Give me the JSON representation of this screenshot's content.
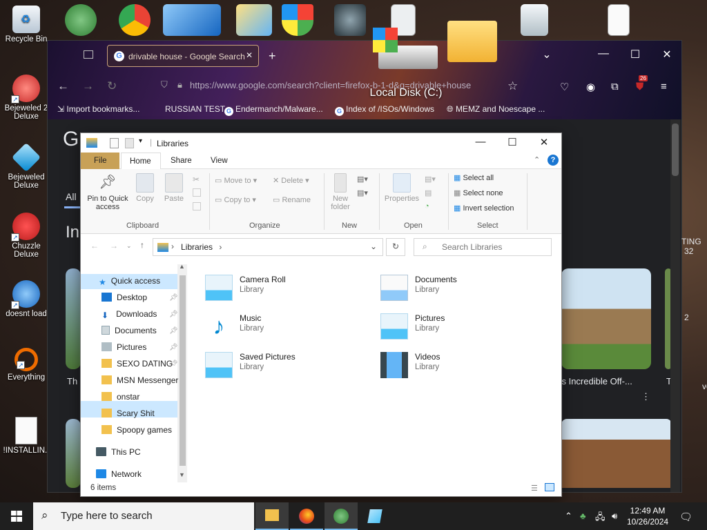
{
  "desktop_icons": [
    {
      "label": "Recycle Bin",
      "color": "#dfe6ee"
    },
    {
      "label": "Bejeweled 2 Deluxe",
      "line1": "Bejeweled 2",
      "line2": "Deluxe",
      "color": "#c62828"
    },
    {
      "label": "Bejeweled Deluxe",
      "line1": "Bejeweled",
      "line2": "Deluxe",
      "color": "#29b6f6"
    },
    {
      "label": "Chuzzle Deluxe",
      "line1": "Chuzzle",
      "line2": "Deluxe",
      "color": "#d32f2f"
    },
    {
      "label": "doesnt load",
      "color": "#1e88e5"
    },
    {
      "label": "Everything",
      "color": "#ef6c00"
    },
    {
      "label": "!INSTALLIN..",
      "color": "#f5f5f5"
    }
  ],
  "overlay_label": "Local Disk (C:)",
  "browser": {
    "tab_title": "drivable house - Google Search",
    "tab_close": "✕",
    "new_tab": "+",
    "url": "https://www.google.com/search?client=firefox-b-1-d&q=drivable+house",
    "extension_badge": "26",
    "bookmarks": [
      "Import bookmarks...",
      "RUSSIAN TEST",
      "Endermanch/Malware...",
      "Index of /ISOs/Windows",
      "MEMZ and Noescape ..."
    ],
    "behind_text": {
      "logo_letter": "G",
      "tab_all": "All",
      "heading_fragment": "In",
      "card_text_left": "Th",
      "card_text_right": "'s Incredible Off-...",
      "card_text_far": "T",
      "card_text_far2": "ved",
      "right_edge_1": "TING",
      "right_edge_2": "32",
      "right_edge_3": "2"
    }
  },
  "explorer": {
    "title": "Libraries",
    "ribbon_tabs": {
      "file": "File",
      "home": "Home",
      "share": "Share",
      "view": "View"
    },
    "clipboard": {
      "pin": "Pin to Quick access",
      "pin_l1": "Pin to Quick",
      "pin_l2": "access",
      "copy": "Copy",
      "paste": "Paste",
      "group": "Clipboard"
    },
    "organize": {
      "move_to": "Move to",
      "copy_to": "Copy to",
      "delete": "Delete",
      "rename": "Rename",
      "group": "Organize"
    },
    "new": {
      "new_folder_l1": "New",
      "new_folder_l2": "folder",
      "group": "New"
    },
    "open": {
      "properties": "Properties",
      "group": "Open"
    },
    "select": {
      "select_all": "Select all",
      "select_none": "Select none",
      "invert": "Invert selection",
      "group": "Select"
    },
    "address": "Libraries",
    "address_sep": "›",
    "search_placeholder": "Search Libraries",
    "nav": [
      {
        "label": "Quick access",
        "color": "#1e88e5",
        "pinned": false
      },
      {
        "label": "Desktop",
        "color": "#1976d2",
        "pinned": true
      },
      {
        "label": "Downloads",
        "color": "#1565c0",
        "pinned": true
      },
      {
        "label": "Documents",
        "color": "#90a4ae",
        "pinned": true
      },
      {
        "label": "Pictures",
        "color": "#78909c",
        "pinned": true
      },
      {
        "label": "SEXO DATING",
        "color": "#f2c14e",
        "pinned": true
      },
      {
        "label": "MSN Messenger",
        "color": "#f2c14e",
        "pinned": false
      },
      {
        "label": "onstar",
        "color": "#f2c14e",
        "pinned": false
      },
      {
        "label": "Scary Shit",
        "color": "#f2c14e",
        "pinned": false
      },
      {
        "label": "Spoopy games",
        "color": "#f2c14e",
        "pinned": false
      },
      {
        "label": "This PC",
        "color": "#455a64",
        "pinned": false
      },
      {
        "label": "Network",
        "color": "#1e88e5",
        "pinned": false
      }
    ],
    "libraries": [
      {
        "name": "Camera Roll",
        "type": "Library",
        "icon": "camera-roll-icon",
        "color": "#4fc3f7"
      },
      {
        "name": "Documents",
        "type": "Library",
        "icon": "documents-icon",
        "color": "#90caf9"
      },
      {
        "name": "Music",
        "type": "Library",
        "icon": "music-icon",
        "color": "#0288d1"
      },
      {
        "name": "Pictures",
        "type": "Library",
        "icon": "pictures-icon",
        "color": "#4fc3f7"
      },
      {
        "name": "Saved Pictures",
        "type": "Library",
        "icon": "saved-pictures-icon",
        "color": "#4fc3f7"
      },
      {
        "name": "Videos",
        "type": "Library",
        "icon": "videos-icon",
        "color": "#37474f"
      }
    ],
    "status": "6 items"
  },
  "taskbar": {
    "search_placeholder": "Type here to search",
    "time": "12:49 AM",
    "date": "10/26/2024"
  }
}
